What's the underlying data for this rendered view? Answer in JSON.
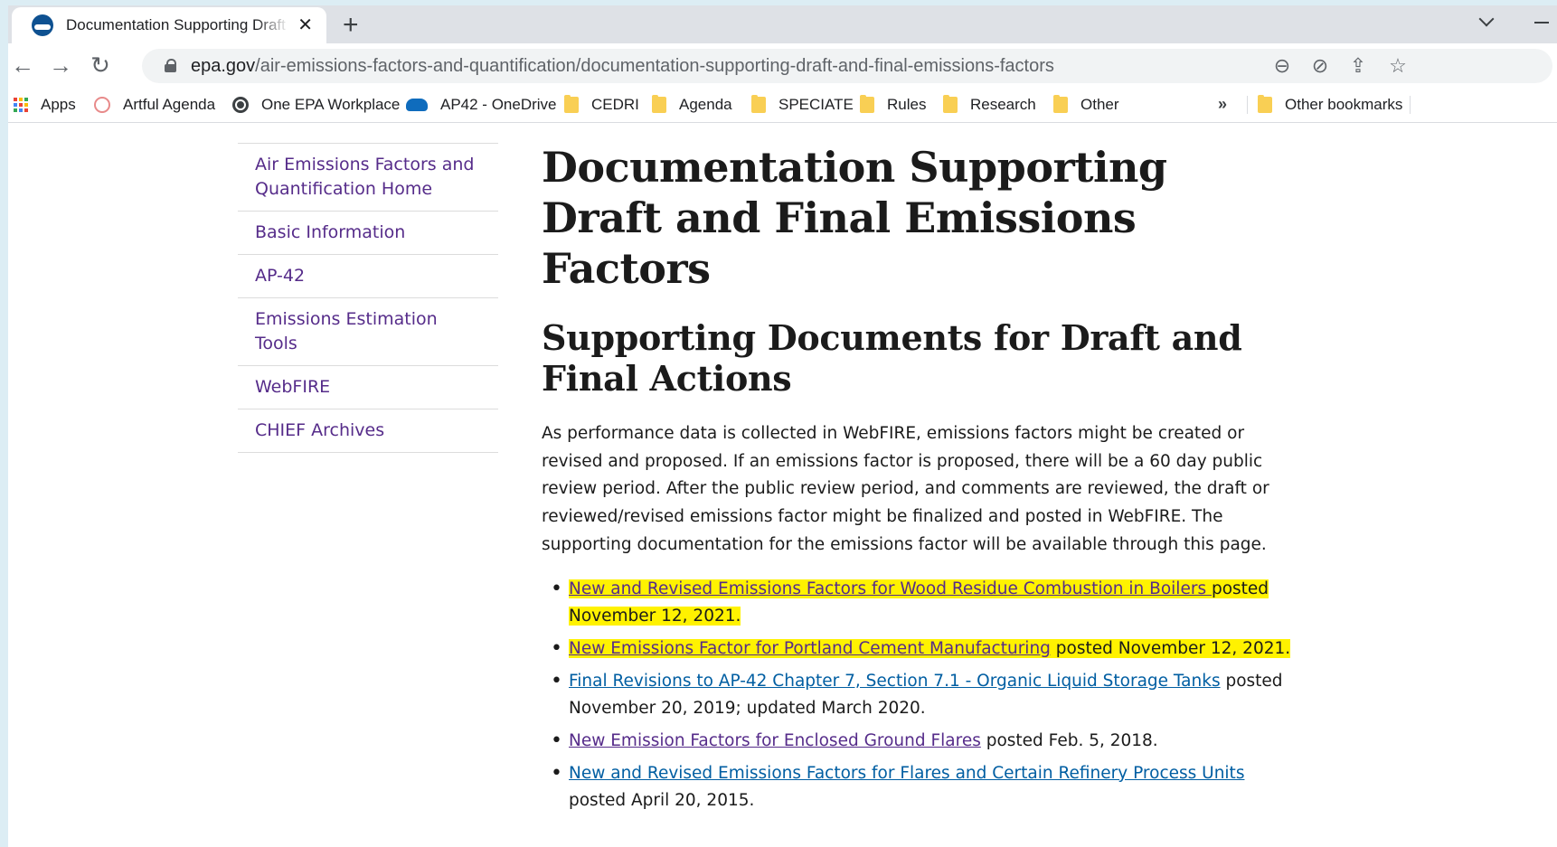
{
  "browser": {
    "tab_title": "Documentation Supporting Draft and Final Emissions Factors | US EPA",
    "tab_close": "✕",
    "new_tab": "+",
    "url_host": "epa.gov",
    "url_path": "/air-emissions-factors-and-quantification/documentation-supporting-draft-and-final-emissions-factors",
    "back_icon": "←",
    "forward_icon": "→",
    "reload_icon": "↻",
    "zoom_icon": "⊖",
    "eye_off_icon": "⊘",
    "share_icon": "⇪",
    "star_icon": "☆"
  },
  "bookmarks": {
    "items": [
      "Apps",
      "Artful Agenda",
      "One EPA Workplace",
      "AP42 - OneDrive",
      "CEDRI",
      "Agenda",
      "SPECIATE",
      "Rules",
      "Research",
      "Other"
    ],
    "overflow": "»",
    "other_bookmarks": "Other bookmarks"
  },
  "sidenav": {
    "items": [
      "Air Emissions Factors and Quantification Home",
      "Basic Information",
      "AP-42",
      "Emissions Estimation Tools",
      "WebFIRE",
      "CHIEF Archives"
    ]
  },
  "main": {
    "title": "Documentation Supporting Draft and Final Emissions Factors",
    "subtitle": "Supporting Documents for Draft and Final Actions",
    "intro": "As performance data is collected in WebFIRE, emissions factors might be created or revised and proposed. If an emissions factor is proposed, there will be a 60 day public review period. After the public review period, and comments are reviewed, the draft or reviewed/revised emissions factor might be finalized and posted in WebFIRE. The supporting documentation for the emissions factor will be available through this page.",
    "documents": [
      {
        "link": "New and Revised Emissions Factors for Wood Residue Combustion in Boilers ",
        "posted": "posted November 12, 2021."
      },
      {
        "link": "New Emissions Factor for Portland Cement Manufacturing",
        "posted": " posted November 12, 2021."
      },
      {
        "link": "Final Revisions to AP-42 Chapter 7, Section 7.1 - Organic Liquid Storage Tanks",
        "posted": " posted November 20, 2019; updated March 2020."
      },
      {
        "link": "New Emission Factors for Enclosed Ground Flares",
        "posted": " posted Feb. 5, 2018."
      },
      {
        "link": "New and Revised Emissions Factors for Flares and Certain Refinery Process Units",
        "posted": " posted April 20, 2015."
      }
    ]
  },
  "colors": {
    "highlight": "#fff200",
    "visited_link": "#562c8a",
    "link": "#005ea2"
  }
}
